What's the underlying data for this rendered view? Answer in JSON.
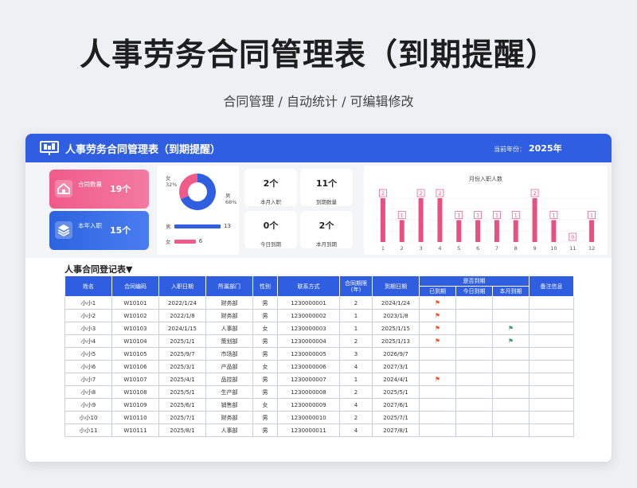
{
  "hero": {
    "title": "人事劳务合同管理表（到期提醒）",
    "subtitle": "合同管理 / 自动统计 / 可编辑修改"
  },
  "header": {
    "title": "人事劳务合同管理表（到期提醒）",
    "year_label": "当前年份：",
    "year_value": "2025年"
  },
  "kpis": [
    {
      "label": "合同数量",
      "value": "19个",
      "icon": "home-icon"
    },
    {
      "label": "本年入职",
      "value": "15个",
      "icon": "layers-icon"
    }
  ],
  "gender": {
    "female_label": "女",
    "female_pct": "32%",
    "male_label": "男",
    "male_pct": "68%",
    "male_count": 13,
    "female_count": 6,
    "male_color": "#2f5ee0",
    "female_color": "#f05b8a"
  },
  "stats": [
    {
      "value": "2个",
      "label": "本月入职"
    },
    {
      "value": "11个",
      "label": "到期数量"
    },
    {
      "value": "0个",
      "label": "今日到期"
    },
    {
      "value": "2个",
      "label": "本月到期"
    }
  ],
  "chart_data": {
    "type": "bar",
    "title": "月份入职人数",
    "categories": [
      "1",
      "2",
      "3",
      "4",
      "5",
      "6",
      "7",
      "8",
      "9",
      "10",
      "11",
      "12"
    ],
    "values": [
      2,
      1,
      2,
      2,
      1,
      1,
      1,
      1,
      2,
      1,
      0,
      1
    ],
    "ylim": [
      0,
      2.4
    ],
    "grid": true,
    "bar_color": "#e8507f"
  },
  "register": {
    "title": "人事合同登记表▼",
    "headers": [
      "姓名",
      "合同编码",
      "入职日期",
      "所属部门",
      "性别",
      "联系方式",
      "合同期限(年)",
      "到期日期",
      "是否到期",
      "备注信息"
    ],
    "subheaders": [
      "已到期",
      "今日到期",
      "本月到期"
    ],
    "rows": [
      [
        "小小1",
        "W10101",
        "2022/1/24",
        "财务部",
        "男",
        "1230000001",
        "2",
        "2024/1/24"
      ],
      [
        "小小2",
        "W10102",
        "2022/1/8",
        "财务部",
        "男",
        "1230000002",
        "1",
        "2023/1/8"
      ],
      [
        "小小3",
        "W10103",
        "2024/1/15",
        "人事部",
        "女",
        "1230000003",
        "1",
        "2025/1/15"
      ],
      [
        "小小4",
        "W10104",
        "2025/1/1",
        "策划部",
        "男",
        "1230000004",
        "2",
        "2025/1/13"
      ],
      [
        "小小5",
        "W10105",
        "2025/9/7",
        "市场部",
        "男",
        "1230000005",
        "3",
        "2026/9/7"
      ],
      [
        "小小6",
        "W10106",
        "2025/3/1",
        "产品部",
        "女",
        "1230000006",
        "4",
        "2027/3/1"
      ],
      [
        "小小7",
        "W10107",
        "2025/4/1",
        "品控部",
        "男",
        "1230000007",
        "1",
        "2024/4/1"
      ],
      [
        "小小8",
        "W10108",
        "2025/5/1",
        "生产部",
        "男",
        "1230000008",
        "2",
        "2025/5/1"
      ],
      [
        "小小9",
        "W10109",
        "2025/6/1",
        "销售部",
        "女",
        "1230000009",
        "4",
        "2027/6/1"
      ],
      [
        "小小10",
        "W10110",
        "2025/7/1",
        "财务部",
        "男",
        "1230000010",
        "2",
        "2025/7/1"
      ],
      [
        "小小11",
        "W10111",
        "2025/8/1",
        "人事部",
        "男",
        "1230000011",
        "4",
        "2027/8/1"
      ]
    ],
    "flags": [
      [
        "red",
        "",
        ""
      ],
      [
        "red",
        "",
        ""
      ],
      [
        "red",
        "",
        "green"
      ],
      [
        "red",
        "",
        "green"
      ],
      [
        "",
        "",
        ""
      ],
      [
        "",
        "",
        ""
      ],
      [
        "red",
        "",
        ""
      ],
      [
        "",
        "",
        ""
      ],
      [
        "",
        "",
        ""
      ],
      [
        "",
        "",
        ""
      ],
      [
        "",
        "",
        ""
      ]
    ]
  }
}
